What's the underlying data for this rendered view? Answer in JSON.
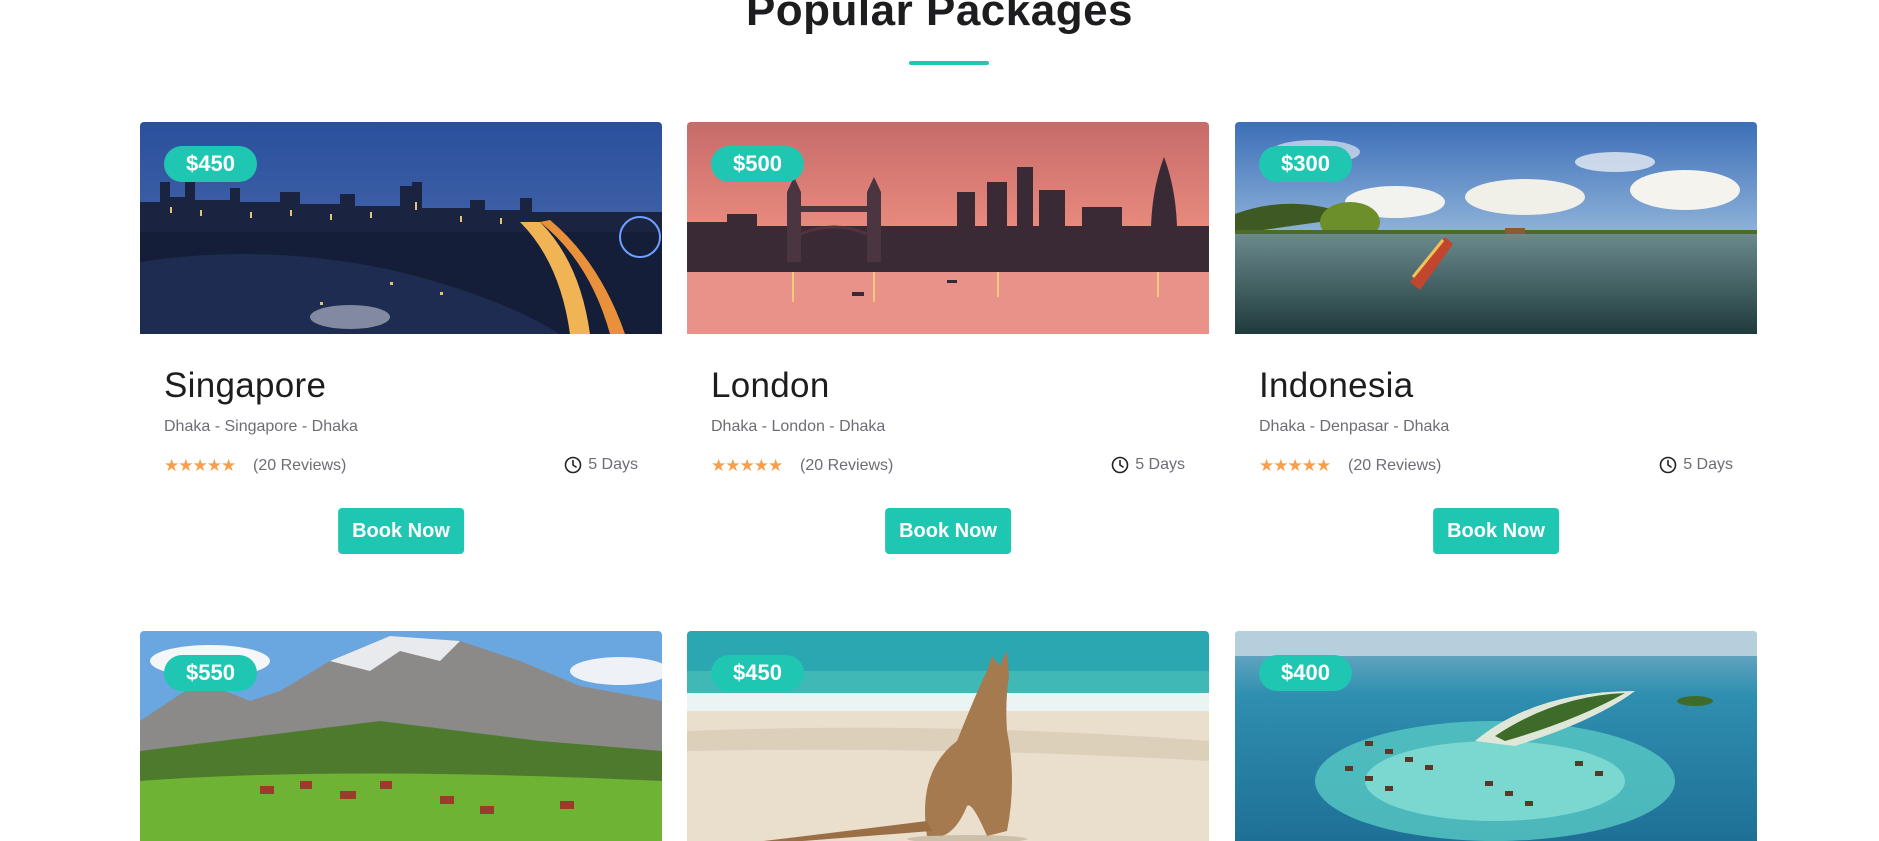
{
  "section": {
    "title": "Popular Packages",
    "accent_color": "#1fc7b3"
  },
  "packages": [
    {
      "price": "$450",
      "name": "Singapore",
      "route": "Dhaka - Singapore - Dhaka",
      "rating": 5,
      "reviews": "(20 Reviews)",
      "duration": "5 Days",
      "button": "Book Now",
      "image": "singapore-skyline-photo"
    },
    {
      "price": "$500",
      "name": "London",
      "route": "Dhaka - London - Dhaka",
      "rating": 5,
      "reviews": "(20 Reviews)",
      "duration": "5 Days",
      "button": "Book Now",
      "image": "london-tower-bridge-photo"
    },
    {
      "price": "$300",
      "name": "Indonesia",
      "route": "Dhaka - Denpasar - Dhaka",
      "rating": 5,
      "reviews": "(20 Reviews)",
      "duration": "5 Days",
      "button": "Book Now",
      "image": "indonesia-boat-lake-photo"
    },
    {
      "price": "$550",
      "image": "alpine-mountain-village-photo"
    },
    {
      "price": "$450",
      "image": "kangaroo-beach-photo"
    },
    {
      "price": "$400",
      "image": "maldives-atoll-photo"
    }
  ],
  "colors": {
    "accent": "#1fc7b3",
    "star": "#f6a04d",
    "muted_text": "#6d6d75",
    "heading": "#1d1d1f"
  }
}
